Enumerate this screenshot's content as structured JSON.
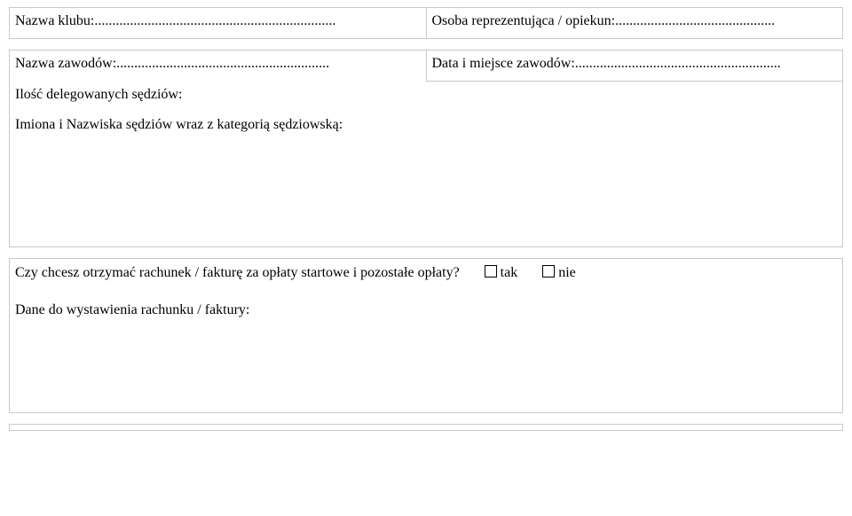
{
  "form": {
    "club_name_label": "Nazwa klubu:",
    "club_name_dots": " ....................................................................",
    "rep_label": "Osoba reprezentująca / opiekun:",
    "rep_dots": " .............................................",
    "competition_name_label": "Nazwa zawodów:",
    "competition_name_dots": " ............................................................",
    "competition_date_label": "Data i miejsce zawodów:",
    "competition_date_dots": " ..........................................................",
    "delegated_judges_label": "Ilość delegowanych sędziów:",
    "judges_names_label": "Imiona i Nazwiska sędziów wraz z kategorią sędziowską:",
    "invoice_question": "Czy chcesz otrzymać rachunek / fakturę za opłaty startowe i pozostałe opłaty?",
    "option_yes": "tak",
    "option_no": "nie",
    "invoice_details_label": "Dane do wystawienia rachunku / faktury:"
  }
}
